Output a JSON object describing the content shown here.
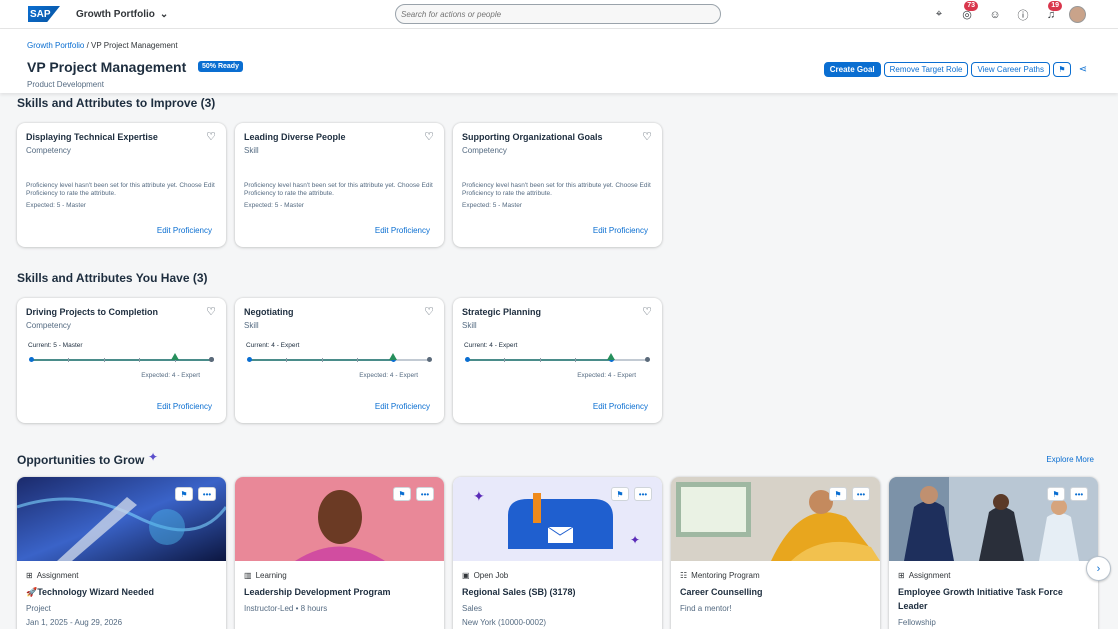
{
  "shell": {
    "logo": "SAP",
    "app_title": "Growth Portfolio",
    "search_placeholder": "Search for actions or people",
    "tasks_badge": "73",
    "notifications_badge": "19"
  },
  "header": {
    "breadcrumb_root": "Growth Portfolio",
    "breadcrumb_sep": " / ",
    "breadcrumb_current": "VP Project Management",
    "title": "VP Project Management",
    "ready_badge": "50% Ready",
    "subtitle": "Product Development",
    "actions": {
      "create_goal": "Create Goal",
      "remove_target": "Remove Target Role",
      "view_paths": "View Career Paths"
    }
  },
  "improve": {
    "title": "Skills and Attributes to Improve (3)",
    "cards": [
      {
        "name": "Displaying Technical Expertise",
        "type": "Competency",
        "message": "Proficiency level hasn't been set for this attribute yet. Choose Edit Proficiency to rate the attribute.",
        "expected": "Expected: 5 - Master",
        "edit": "Edit Proficiency"
      },
      {
        "name": "Leading Diverse People",
        "type": "Skill",
        "message": "Proficiency level hasn't been set for this attribute yet. Choose Edit Proficiency to rate the attribute.",
        "expected": "Expected: 5 - Master",
        "edit": "Edit Proficiency"
      },
      {
        "name": "Supporting Organizational Goals",
        "type": "Competency",
        "message": "Proficiency level hasn't been set for this attribute yet. Choose Edit Proficiency to rate the attribute.",
        "expected": "Expected: 5 - Master",
        "edit": "Edit Proficiency"
      }
    ]
  },
  "have": {
    "title": "Skills and Attributes You Have (3)",
    "cards": [
      {
        "name": "Driving Projects to Completion",
        "type": "Competency",
        "current": "Current: 5 - Master",
        "expected": "Expected: 4 - Expert",
        "current_level": 5,
        "expected_level": 4,
        "max_level": 5,
        "edit": "Edit Proficiency"
      },
      {
        "name": "Negotiating",
        "type": "Skill",
        "current": "Current: 4 - Expert",
        "expected": "Expected: 4 - Expert",
        "current_level": 4,
        "expected_level": 4,
        "max_level": 5,
        "edit": "Edit Proficiency"
      },
      {
        "name": "Strategic Planning",
        "type": "Skill",
        "current": "Current: 4 - Expert",
        "expected": "Expected: 4 - Expert",
        "current_level": 4,
        "expected_level": 4,
        "max_level": 5,
        "edit": "Edit Proficiency"
      }
    ]
  },
  "opportunities": {
    "title": "Opportunities to Grow",
    "explore_more": "Explore More",
    "items": [
      {
        "category": "Assignment",
        "title": "🚀Technology Wizard Needed",
        "line1": "Project",
        "line2": "Jan 1, 2025 - Aug 29, 2026"
      },
      {
        "category": "Learning",
        "title": "Leadership Development Program",
        "line1": "Instructor-Led • 8 hours",
        "line2": ""
      },
      {
        "category": "Open Job",
        "title": "Regional Sales (SB) (3178)",
        "line1": "Sales",
        "line2": "New York (10000-0002)"
      },
      {
        "category": "Mentoring Program",
        "title": "Career Counselling",
        "line1": "Find a mentor!",
        "line2": ""
      },
      {
        "category": "Assignment",
        "title": "Employee Growth Initiative Task Force Leader",
        "line1": "Fellowship",
        "line2": ""
      }
    ]
  },
  "colors": {
    "accent": "#0a6ed1",
    "expected_marker": "#268f5c",
    "track_fill": "#4a8c8a"
  }
}
